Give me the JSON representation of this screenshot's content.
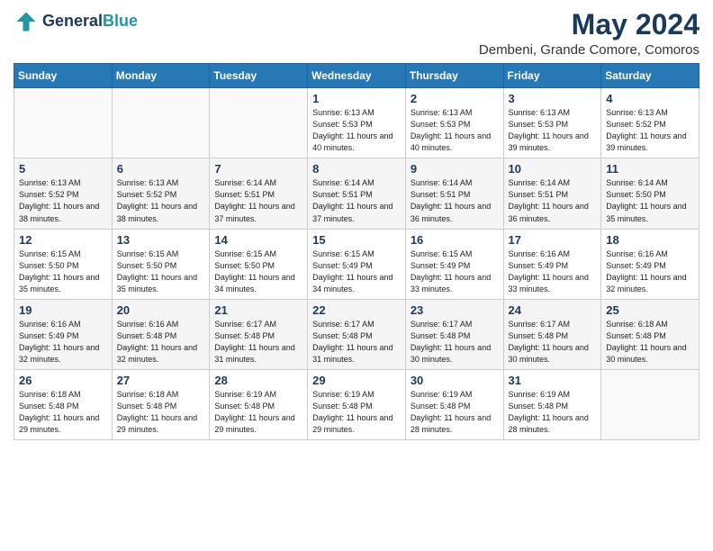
{
  "header": {
    "logo_line1": "General",
    "logo_line2": "Blue",
    "month_year": "May 2024",
    "location": "Dembeni, Grande Comore, Comoros"
  },
  "weekdays": [
    "Sunday",
    "Monday",
    "Tuesday",
    "Wednesday",
    "Thursday",
    "Friday",
    "Saturday"
  ],
  "weeks": [
    [
      {
        "day": "",
        "info": ""
      },
      {
        "day": "",
        "info": ""
      },
      {
        "day": "",
        "info": ""
      },
      {
        "day": "1",
        "info": "Sunrise: 6:13 AM\nSunset: 5:53 PM\nDaylight: 11 hours and 40 minutes."
      },
      {
        "day": "2",
        "info": "Sunrise: 6:13 AM\nSunset: 5:53 PM\nDaylight: 11 hours and 40 minutes."
      },
      {
        "day": "3",
        "info": "Sunrise: 6:13 AM\nSunset: 5:53 PM\nDaylight: 11 hours and 39 minutes."
      },
      {
        "day": "4",
        "info": "Sunrise: 6:13 AM\nSunset: 5:52 PM\nDaylight: 11 hours and 39 minutes."
      }
    ],
    [
      {
        "day": "5",
        "info": "Sunrise: 6:13 AM\nSunset: 5:52 PM\nDaylight: 11 hours and 38 minutes."
      },
      {
        "day": "6",
        "info": "Sunrise: 6:13 AM\nSunset: 5:52 PM\nDaylight: 11 hours and 38 minutes."
      },
      {
        "day": "7",
        "info": "Sunrise: 6:14 AM\nSunset: 5:51 PM\nDaylight: 11 hours and 37 minutes."
      },
      {
        "day": "8",
        "info": "Sunrise: 6:14 AM\nSunset: 5:51 PM\nDaylight: 11 hours and 37 minutes."
      },
      {
        "day": "9",
        "info": "Sunrise: 6:14 AM\nSunset: 5:51 PM\nDaylight: 11 hours and 36 minutes."
      },
      {
        "day": "10",
        "info": "Sunrise: 6:14 AM\nSunset: 5:51 PM\nDaylight: 11 hours and 36 minutes."
      },
      {
        "day": "11",
        "info": "Sunrise: 6:14 AM\nSunset: 5:50 PM\nDaylight: 11 hours and 35 minutes."
      }
    ],
    [
      {
        "day": "12",
        "info": "Sunrise: 6:15 AM\nSunset: 5:50 PM\nDaylight: 11 hours and 35 minutes."
      },
      {
        "day": "13",
        "info": "Sunrise: 6:15 AM\nSunset: 5:50 PM\nDaylight: 11 hours and 35 minutes."
      },
      {
        "day": "14",
        "info": "Sunrise: 6:15 AM\nSunset: 5:50 PM\nDaylight: 11 hours and 34 minutes."
      },
      {
        "day": "15",
        "info": "Sunrise: 6:15 AM\nSunset: 5:49 PM\nDaylight: 11 hours and 34 minutes."
      },
      {
        "day": "16",
        "info": "Sunrise: 6:15 AM\nSunset: 5:49 PM\nDaylight: 11 hours and 33 minutes."
      },
      {
        "day": "17",
        "info": "Sunrise: 6:16 AM\nSunset: 5:49 PM\nDaylight: 11 hours and 33 minutes."
      },
      {
        "day": "18",
        "info": "Sunrise: 6:16 AM\nSunset: 5:49 PM\nDaylight: 11 hours and 32 minutes."
      }
    ],
    [
      {
        "day": "19",
        "info": "Sunrise: 6:16 AM\nSunset: 5:49 PM\nDaylight: 11 hours and 32 minutes."
      },
      {
        "day": "20",
        "info": "Sunrise: 6:16 AM\nSunset: 5:48 PM\nDaylight: 11 hours and 32 minutes."
      },
      {
        "day": "21",
        "info": "Sunrise: 6:17 AM\nSunset: 5:48 PM\nDaylight: 11 hours and 31 minutes."
      },
      {
        "day": "22",
        "info": "Sunrise: 6:17 AM\nSunset: 5:48 PM\nDaylight: 11 hours and 31 minutes."
      },
      {
        "day": "23",
        "info": "Sunrise: 6:17 AM\nSunset: 5:48 PM\nDaylight: 11 hours and 30 minutes."
      },
      {
        "day": "24",
        "info": "Sunrise: 6:17 AM\nSunset: 5:48 PM\nDaylight: 11 hours and 30 minutes."
      },
      {
        "day": "25",
        "info": "Sunrise: 6:18 AM\nSunset: 5:48 PM\nDaylight: 11 hours and 30 minutes."
      }
    ],
    [
      {
        "day": "26",
        "info": "Sunrise: 6:18 AM\nSunset: 5:48 PM\nDaylight: 11 hours and 29 minutes."
      },
      {
        "day": "27",
        "info": "Sunrise: 6:18 AM\nSunset: 5:48 PM\nDaylight: 11 hours and 29 minutes."
      },
      {
        "day": "28",
        "info": "Sunrise: 6:19 AM\nSunset: 5:48 PM\nDaylight: 11 hours and 29 minutes."
      },
      {
        "day": "29",
        "info": "Sunrise: 6:19 AM\nSunset: 5:48 PM\nDaylight: 11 hours and 29 minutes."
      },
      {
        "day": "30",
        "info": "Sunrise: 6:19 AM\nSunset: 5:48 PM\nDaylight: 11 hours and 28 minutes."
      },
      {
        "day": "31",
        "info": "Sunrise: 6:19 AM\nSunset: 5:48 PM\nDaylight: 11 hours and 28 minutes."
      },
      {
        "day": "",
        "info": ""
      }
    ]
  ]
}
